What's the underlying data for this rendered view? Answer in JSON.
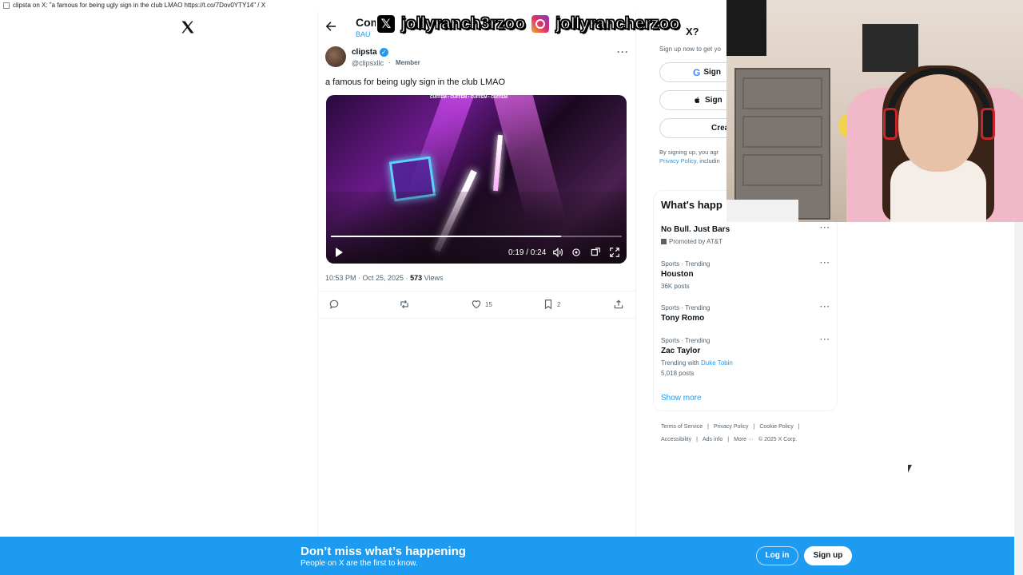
{
  "window": {
    "title": "clipsta on X: \"a famous for being ugly sign in the club LMAO https://t.co/7Dov0YTY14\" / X"
  },
  "header": {
    "community_title": "Com",
    "community_sub": "BAU"
  },
  "tweet": {
    "display_name": "clipsta",
    "handle": "@clipsxllc",
    "badge": "Member",
    "text": "a famous for being ugly sign in the club LMAO",
    "video": {
      "time": "0:19 / 0:24",
      "progress_fraction": 0.79,
      "top_caption": "CUFFEM • CUFFEM • CUFFEM • CUFFEM"
    },
    "timestamp": "10:53 PM · Oct 25, 2025 ·",
    "views_count": "573",
    "views_label": "Views",
    "likes": "15",
    "bookmarks": "2"
  },
  "right_sidebar": {
    "signup_heading_tail": "X?",
    "signup_text": "Sign up now to get yo",
    "google_label": "Sign",
    "apple_label": "Sign",
    "create_label": "Crea",
    "terms_text": "By signing up, you agr",
    "privacy_link": "Privacy Policy",
    "privacy_tail": ", includin",
    "trends_title": "What's happ",
    "trends": [
      {
        "category": "",
        "name": "No Bull. Just Bars",
        "promoted": "Promoted by AT&T",
        "count": "",
        "with_label": "",
        "with_link": ""
      },
      {
        "category": "Sports · Trending",
        "name": "Houston",
        "promoted": "",
        "count": "36K posts",
        "with_label": "",
        "with_link": ""
      },
      {
        "category": "Sports · Trending",
        "name": "Tony Romo",
        "promoted": "",
        "count": "",
        "with_label": "",
        "with_link": ""
      },
      {
        "category": "Sports · Trending",
        "name": "Zac Taylor",
        "promoted": "",
        "count": "5,018 posts",
        "with_label": "Trending with",
        "with_link": "Duke Tobin"
      }
    ],
    "show_more": "Show more",
    "footer": {
      "terms": "Terms of Service",
      "privacy": "Privacy Policy",
      "cookie": "Cookie Policy",
      "accessibility": "Accessibility",
      "ads": "Ads info",
      "more": "More ···",
      "copyright": "© 2025 X Corp."
    }
  },
  "banner": {
    "title": "Don’t miss what’s happening",
    "subtitle": "People on X are the first to know.",
    "login": "Log in",
    "signup": "Sign up"
  },
  "overlay": {
    "x_handle": "jollyranch3rzoo",
    "ig_handle": "jollyrancherzoo"
  },
  "colors": {
    "accent": "#1d9bf0",
    "text": "#0f1419",
    "secondary": "#536471"
  }
}
